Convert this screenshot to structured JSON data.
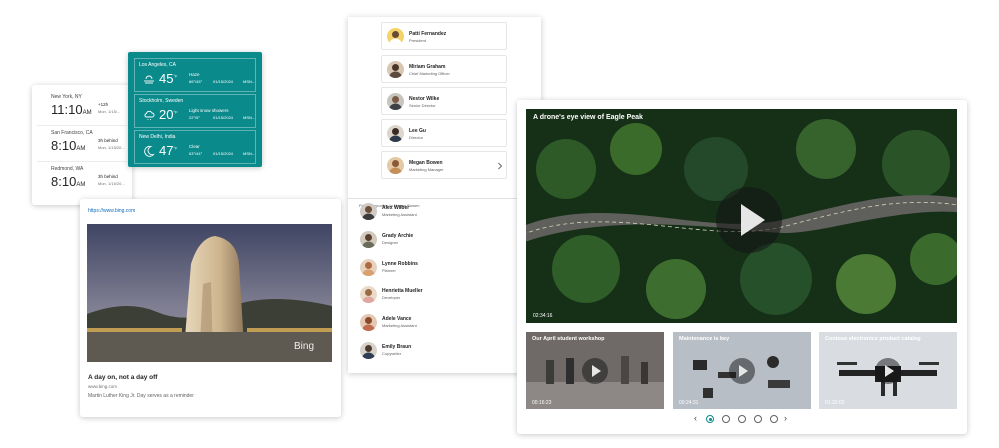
{
  "clock": {
    "items": [
      {
        "city": "New York, NY",
        "time": "11:10",
        "ampm": "AM",
        "relative": "+12h",
        "date": "Mon, 1/15/..."
      },
      {
        "city": "San Francisco, CA",
        "time": "8:10",
        "ampm": "AM",
        "relative": "3h behind",
        "date": "Mon, 1/15/20..."
      },
      {
        "city": "Redmond, WA",
        "time": "8:10",
        "ampm": "AM",
        "relative": "3h behind",
        "date": "Mon, 1/15/20..."
      }
    ]
  },
  "weather": {
    "items": [
      {
        "city": "Los Angeles, CA",
        "temp": "45",
        "unit": "°F",
        "condition": "Haze",
        "hilo": "66°/45°",
        "date": "01/15/2024",
        "source": "MSN...",
        "icon": "haze-icon"
      },
      {
        "city": "Stockholm, Sweden",
        "temp": "20",
        "unit": "°F",
        "condition": "Light snow showers",
        "hilo": "22°/5°",
        "date": "01/15/2024",
        "source": "MSN...",
        "icon": "cloud-snow-icon"
      },
      {
        "city": "New Delhi, India",
        "temp": "47",
        "unit": "°F",
        "condition": "Clear",
        "hilo": "63°/44°",
        "date": "01/15/2024",
        "source": "MSN...",
        "icon": "moon-icon"
      }
    ],
    "bg_color": "#0b8a8c"
  },
  "link_preview": {
    "url": "https://www.bing.com",
    "title": "A day on, not a day off",
    "domain": "www.bing.com",
    "description": "Martin Luther King Jr. Day serves as a reminder",
    "image_brand": "Bing"
  },
  "org": {
    "managers": [
      {
        "name": "Patti Fernandez",
        "title": "President"
      },
      {
        "name": "Miriam Graham",
        "title": "Chief Marketing Officer"
      },
      {
        "name": "Nestor Wilke",
        "title": "Senior Director"
      },
      {
        "name": "Lee Gu",
        "title": "Director"
      },
      {
        "name": "Megan Bowen",
        "title": "Marketing Manager"
      }
    ],
    "reports_heading": "People reporting to Megan Bowen",
    "reports": [
      {
        "name": "Alex Wilber",
        "title": "Marketing Assistant"
      },
      {
        "name": "Grady Archie",
        "title": "Designer"
      },
      {
        "name": "Lynne Robbins",
        "title": "Planner"
      },
      {
        "name": "Henrietta Mueller",
        "title": "Developer"
      },
      {
        "name": "Adele Vance",
        "title": "Marketing Assistant"
      },
      {
        "name": "Emily Braun",
        "title": "Copywriter"
      }
    ]
  },
  "video": {
    "hero": {
      "title": "A drone's eye view of Eagle Peak",
      "duration": "02:34:16"
    },
    "thumbnails": [
      {
        "title": "Our April student workshop",
        "duration": "00:16:23"
      },
      {
        "title": "Maintenance is key",
        "duration": "00:24:31"
      },
      {
        "title": "Contoso electronics product catalog",
        "duration": "01:32:03"
      }
    ],
    "pager": {
      "pages": 5,
      "active": 1
    },
    "accent": "#0b8a8c"
  }
}
